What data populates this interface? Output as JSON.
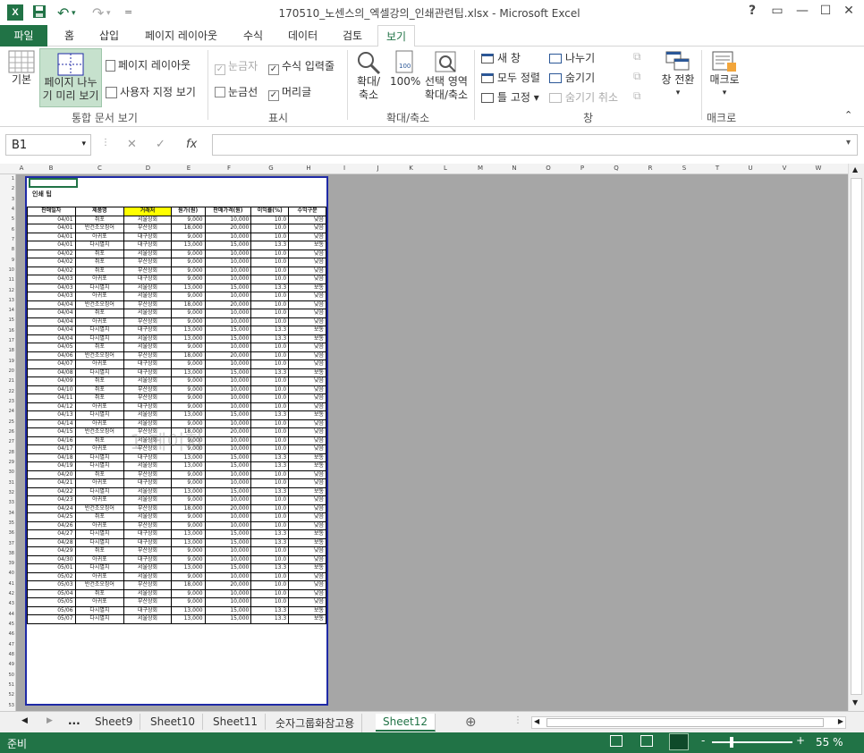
{
  "window": {
    "title": "170510_노센스의_엑셀강의_인쇄관련팁.xlsx - Microsoft Excel",
    "help": "?",
    "restore_ribbon": "▭",
    "minimize": "—",
    "maximize": "☐",
    "close": "✕",
    "app_icon": "X",
    "qat": {
      "save": "💾",
      "undo": "↶",
      "redo": "↷",
      "customize": "="
    }
  },
  "tabs": [
    "파일",
    "홈",
    "삽입",
    "페이지 레이아웃",
    "수식",
    "데이터",
    "검토",
    "보기"
  ],
  "active_tab": "보기",
  "ribbon": {
    "workbook_views": {
      "normal": "기본",
      "page_break_preview_1": "페이지 나누",
      "page_break_preview_2": "기 미리 보기",
      "page_layout": "페이지 레이아웃",
      "custom_views": "사용자 지정 보기",
      "label": "통합 문서 보기"
    },
    "show": {
      "ruler": "눈금자",
      "formula_bar": "수식 입력줄",
      "gridlines": "눈금선",
      "headings": "머리글",
      "label": "표시",
      "checks": {
        "ruler": true,
        "formula_bar": true,
        "gridlines": false,
        "headings": true
      }
    },
    "zoom": {
      "zoom_1": "확대/",
      "zoom_2": "축소",
      "hundred": "100%",
      "selection_1": "선택 영역",
      "selection_2": "확대/축소",
      "label": "확대/축소"
    },
    "window": {
      "new_window": "새 창",
      "arrange_all": "모두 정렬",
      "freeze": "틀 고정",
      "split": "나누기",
      "hide": "숨기기",
      "unhide": "숨기기 취소",
      "switch_1": "창 전환",
      "label": "창"
    },
    "macros": {
      "macro": "매크로",
      "label": "매크로"
    }
  },
  "formula_bar": {
    "name_box": "B1",
    "cancel": "✕",
    "enter": "✓",
    "fx": "fx",
    "value": ""
  },
  "columns": [
    "A",
    "B",
    "C",
    "D",
    "E",
    "F",
    "G",
    "H",
    "I",
    "J",
    "K",
    "L",
    "M",
    "N",
    "O",
    "P",
    "Q",
    "R",
    "S",
    "T",
    "U",
    "V",
    "W"
  ],
  "sheet": {
    "title": "인쇄 팁",
    "watermark": "1 페이지",
    "headers": [
      "판매일자",
      "제품명",
      "거래처",
      "원가(원)",
      "판매가격(원)",
      "이익률(%)",
      "수익구분"
    ],
    "highlight_header": "거래처",
    "rows": [
      [
        "04/01",
        "쥐포",
        "서울상회",
        "9,000",
        "10,000",
        "10.0",
        "낮음"
      ],
      [
        "04/01",
        "반건조오징어",
        "부산상회",
        "18,000",
        "20,000",
        "10.0",
        "낮음"
      ],
      [
        "04/01",
        "아귀포",
        "대구상회",
        "9,000",
        "10,000",
        "10.0",
        "낮음"
      ],
      [
        "04/01",
        "다시멸치",
        "대구상회",
        "13,000",
        "15,000",
        "13.3",
        "보통"
      ],
      [
        "04/02",
        "쥐포",
        "서울상회",
        "9,000",
        "10,000",
        "10.0",
        "낮음"
      ],
      [
        "04/02",
        "쥐포",
        "부산상회",
        "9,000",
        "10,000",
        "10.0",
        "낮음"
      ],
      [
        "04/02",
        "쥐포",
        "부산상회",
        "9,000",
        "10,000",
        "10.0",
        "낮음"
      ],
      [
        "04/03",
        "아귀포",
        "대구상회",
        "9,000",
        "10,000",
        "10.0",
        "낮음"
      ],
      [
        "04/03",
        "다시멸치",
        "서울상회",
        "13,000",
        "15,000",
        "13.3",
        "보통"
      ],
      [
        "04/03",
        "아귀포",
        "서울상회",
        "9,000",
        "10,000",
        "10.0",
        "낮음"
      ],
      [
        "04/04",
        "반건조오징어",
        "부산상회",
        "18,000",
        "20,000",
        "10.0",
        "낮음"
      ],
      [
        "04/04",
        "쥐포",
        "서울상회",
        "9,000",
        "10,000",
        "10.0",
        "낮음"
      ],
      [
        "04/04",
        "아귀포",
        "부산상회",
        "9,000",
        "10,000",
        "10.0",
        "낮음"
      ],
      [
        "04/04",
        "다시멸치",
        "대구상회",
        "13,000",
        "15,000",
        "13.3",
        "보통"
      ],
      [
        "04/04",
        "다시멸치",
        "서울상회",
        "13,000",
        "15,000",
        "13.3",
        "보통"
      ],
      [
        "04/05",
        "쥐포",
        "서울상회",
        "9,000",
        "10,000",
        "10.0",
        "낮음"
      ],
      [
        "04/06",
        "반건조오징어",
        "부산상회",
        "18,000",
        "20,000",
        "10.0",
        "낮음"
      ],
      [
        "04/07",
        "아귀포",
        "대구상회",
        "9,000",
        "10,000",
        "10.0",
        "낮음"
      ],
      [
        "04/08",
        "다시멸치",
        "대구상회",
        "13,000",
        "15,000",
        "13.3",
        "보통"
      ],
      [
        "04/09",
        "쥐포",
        "서울상회",
        "9,000",
        "10,000",
        "10.0",
        "낮음"
      ],
      [
        "04/10",
        "쥐포",
        "부산상회",
        "9,000",
        "10,000",
        "10.0",
        "낮음"
      ],
      [
        "04/11",
        "쥐포",
        "부산상회",
        "9,000",
        "10,000",
        "10.0",
        "낮음"
      ],
      [
        "04/12",
        "아귀포",
        "대구상회",
        "9,000",
        "10,000",
        "10.0",
        "낮음"
      ],
      [
        "04/13",
        "다시멸치",
        "서울상회",
        "13,000",
        "15,000",
        "13.3",
        "보통"
      ],
      [
        "04/14",
        "아귀포",
        "서울상회",
        "9,000",
        "10,000",
        "10.0",
        "낮음"
      ],
      [
        "04/15",
        "반건조오징어",
        "부산상회",
        "18,000",
        "20,000",
        "10.0",
        "낮음"
      ],
      [
        "04/16",
        "쥐포",
        "서울상회",
        "9,000",
        "10,000",
        "10.0",
        "낮음"
      ],
      [
        "04/17",
        "아귀포",
        "부산상회",
        "9,000",
        "10,000",
        "10.0",
        "낮음"
      ],
      [
        "04/18",
        "다시멸치",
        "대구상회",
        "13,000",
        "15,000",
        "13.3",
        "보통"
      ],
      [
        "04/19",
        "다시멸치",
        "서울상회",
        "13,000",
        "15,000",
        "13.3",
        "보통"
      ],
      [
        "04/20",
        "쥐포",
        "부산상회",
        "9,000",
        "10,000",
        "10.0",
        "낮음"
      ],
      [
        "04/21",
        "아귀포",
        "대구상회",
        "9,000",
        "10,000",
        "10.0",
        "낮음"
      ],
      [
        "04/22",
        "다시멸치",
        "서울상회",
        "13,000",
        "15,000",
        "13.3",
        "보통"
      ],
      [
        "04/23",
        "아귀포",
        "서울상회",
        "9,000",
        "10,000",
        "10.0",
        "낮음"
      ],
      [
        "04/24",
        "반건조오징어",
        "부산상회",
        "18,000",
        "20,000",
        "10.0",
        "낮음"
      ],
      [
        "04/25",
        "쥐포",
        "서울상회",
        "9,000",
        "10,000",
        "10.0",
        "낮음"
      ],
      [
        "04/26",
        "아귀포",
        "부산상회",
        "9,000",
        "10,000",
        "10.0",
        "낮음"
      ],
      [
        "04/27",
        "다시멸치",
        "대구상회",
        "13,000",
        "15,000",
        "13.3",
        "보통"
      ],
      [
        "04/28",
        "다시멸치",
        "대구상회",
        "13,000",
        "15,000",
        "13.3",
        "보통"
      ],
      [
        "04/29",
        "쥐포",
        "부산상회",
        "9,000",
        "10,000",
        "10.0",
        "낮음"
      ],
      [
        "04/30",
        "아귀포",
        "대구상회",
        "9,000",
        "10,000",
        "10.0",
        "낮음"
      ],
      [
        "05/01",
        "다시멸치",
        "서울상회",
        "13,000",
        "15,000",
        "13.3",
        "보통"
      ],
      [
        "05/02",
        "아귀포",
        "서울상회",
        "9,000",
        "10,000",
        "10.0",
        "낮음"
      ],
      [
        "05/03",
        "반건조오징어",
        "부산상회",
        "18,000",
        "20,000",
        "10.0",
        "낮음"
      ],
      [
        "05/04",
        "쥐포",
        "서울상회",
        "9,000",
        "10,000",
        "10.0",
        "낮음"
      ],
      [
        "05/05",
        "아귀포",
        "부산상회",
        "9,000",
        "10,000",
        "10.0",
        "낮음"
      ],
      [
        "05/06",
        "다시멸치",
        "대구상회",
        "13,000",
        "15,000",
        "13.3",
        "보통"
      ],
      [
        "05/07",
        "다시멸치",
        "서울상회",
        "13,000",
        "15,000",
        "13.3",
        "보통"
      ]
    ]
  },
  "sheet_tabs": [
    "Sheet9",
    "Sheet10",
    "Sheet11",
    "숫자그룹화참고용",
    "Sheet12"
  ],
  "active_sheet": "Sheet12",
  "sheet_nav": {
    "prev": "◀",
    "next": "▶",
    "more": "...",
    "add": "⊕"
  },
  "status": {
    "ready": "준비",
    "zoom": "55 %",
    "minus": "-",
    "plus": "+"
  },
  "colors": {
    "accent": "#217346",
    "page_border": "#1f2aa6",
    "highlight": "#ffff00"
  }
}
